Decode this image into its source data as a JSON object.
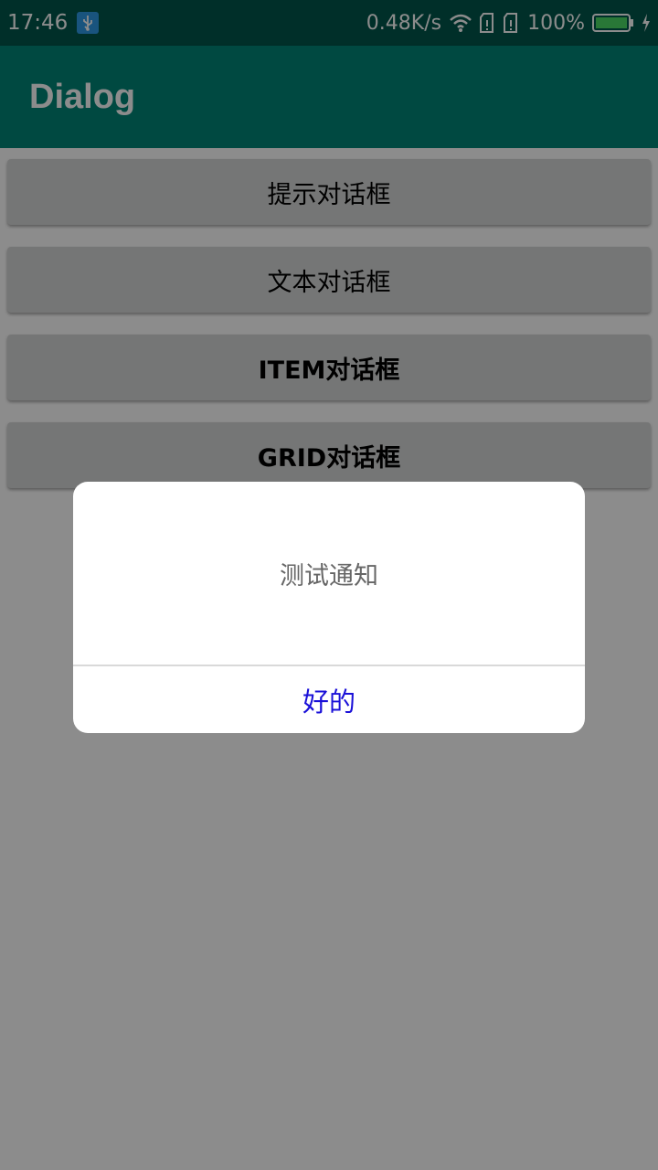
{
  "status_bar": {
    "time": "17:46",
    "network_speed": "0.48K/s",
    "battery_percent": "100%",
    "icons": [
      "usb-icon",
      "wifi-icon",
      "sim1-icon",
      "sim2-icon",
      "battery-icon",
      "charging-icon"
    ]
  },
  "app_bar": {
    "title": "Dialog",
    "color": "#008577"
  },
  "buttons": [
    {
      "label": "提示对话框"
    },
    {
      "label": "文本对话框"
    },
    {
      "label": "ITEM对话框"
    },
    {
      "label": "GRID对话框"
    }
  ],
  "dialog": {
    "message": "测试通知",
    "ok_label": "好的",
    "ok_color": "#1a10d8"
  }
}
